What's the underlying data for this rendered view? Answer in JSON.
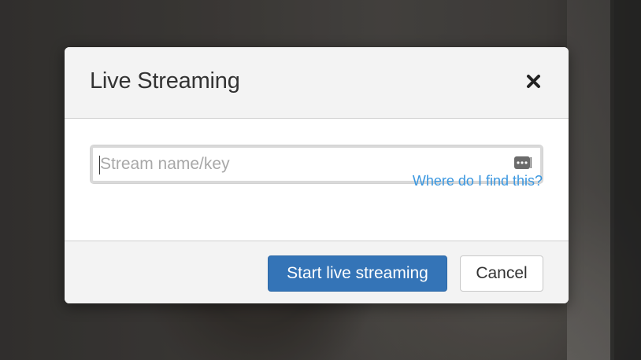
{
  "dialog": {
    "title": "Live Streaming",
    "close_icon": "close-icon"
  },
  "stream": {
    "placeholder": "Stream name/key",
    "value": "",
    "key_icon": "password-dots-icon"
  },
  "help_link": "Where do I find this?",
  "footer": {
    "start_label": "Start live streaming",
    "cancel_label": "Cancel"
  },
  "colors": {
    "primary": "#3474b7",
    "link": "#3a97e0"
  }
}
